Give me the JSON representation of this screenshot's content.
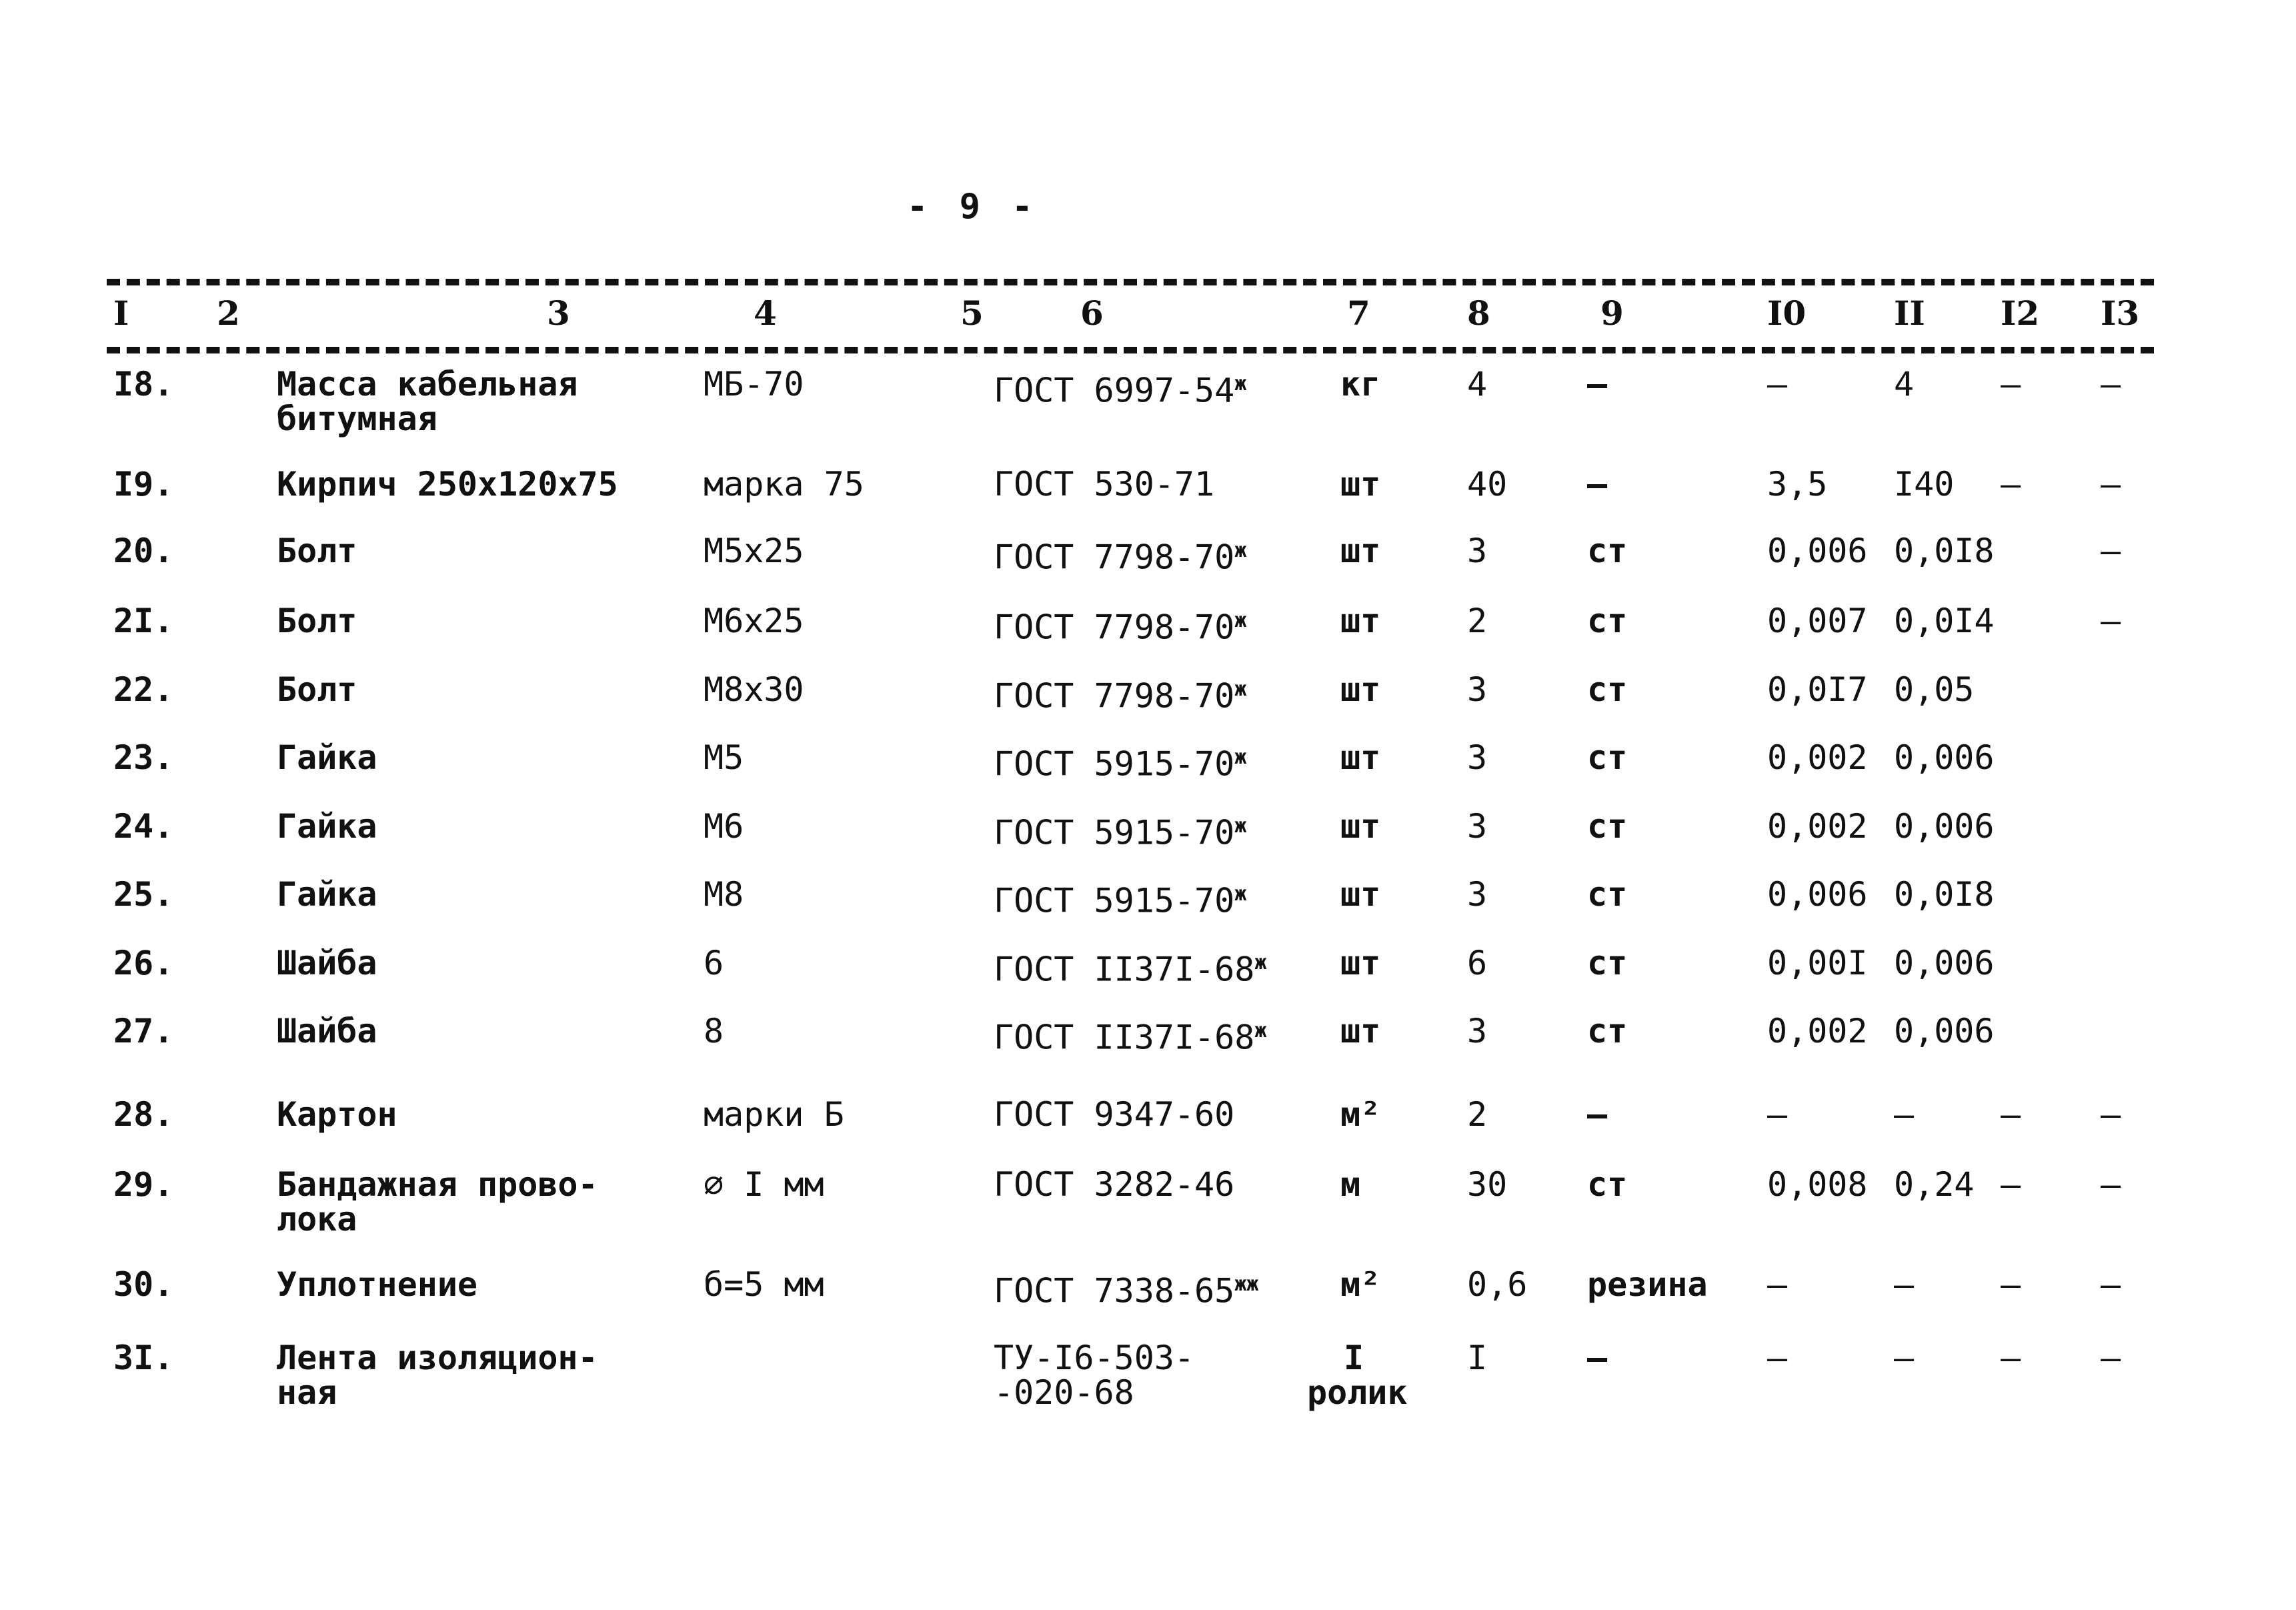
{
  "page": {
    "page_number": "- 9 -"
  },
  "table": {
    "column_headers": [
      "I",
      "2",
      "3",
      "4",
      "5",
      "6",
      "7",
      "8",
      "9",
      "I0",
      "II",
      "I2",
      "I3"
    ],
    "rows": [
      {
        "num": "I8.",
        "name": "Масса кабельная\nбитумная",
        "grade": "МБ-70",
        "standard": "ГОСТ 6997-54",
        "standard_mark": "ж",
        "unit": "кг",
        "qty": "4",
        "material": "–",
        "c10": "–",
        "c11": "4",
        "c12": "–",
        "c13": "–"
      },
      {
        "num": "I9.",
        "name": "Кирпич 250х120х75",
        "grade": "марка 75",
        "standard": "ГОСТ 530-71",
        "standard_mark": "",
        "unit": "шт",
        "qty": "40",
        "material": "–",
        "c10": "3,5",
        "c11": "I40",
        "c12": "–",
        "c13": "–"
      },
      {
        "num": "20.",
        "name": "Болт",
        "grade": "М5х25",
        "standard": "ГОСТ 7798-70",
        "standard_mark": "ж",
        "unit": "шт",
        "qty": "3",
        "material": "ст",
        "c10": "0,006",
        "c11": "0,0I8",
        "c12": "",
        "c13": "–"
      },
      {
        "num": "2I.",
        "name": "Болт",
        "grade": "М6х25",
        "standard": "ГОСТ 7798-70",
        "standard_mark": "ж",
        "unit": "шт",
        "qty": "2",
        "material": "ст",
        "c10": "0,007",
        "c11": "0,0I4",
        "c12": "",
        "c13": "–"
      },
      {
        "num": "22.",
        "name": "Болт",
        "grade": "М8х30",
        "standard": "ГОСТ 7798-70",
        "standard_mark": "ж",
        "unit": "шт",
        "qty": "3",
        "material": "ст",
        "c10": "0,0I7",
        "c11": "0,05",
        "c12": "",
        "c13": ""
      },
      {
        "num": "23.",
        "name": "Гайка",
        "grade": "М5",
        "standard": "ГОСТ 5915-70",
        "standard_mark": "ж",
        "unit": "шт",
        "qty": "3",
        "material": "ст",
        "c10": "0,002",
        "c11": "0,006",
        "c12": "",
        "c13": ""
      },
      {
        "num": "24.",
        "name": "Гайка",
        "grade": "М6",
        "standard": "ГОСТ 5915-70",
        "standard_mark": "ж",
        "unit": "шт",
        "qty": "3",
        "material": "ст",
        "c10": "0,002",
        "c11": "0,006",
        "c12": "",
        "c13": ""
      },
      {
        "num": "25.",
        "name": "Гайка",
        "grade": "М8",
        "standard": "ГОСТ 5915-70",
        "standard_mark": "ж",
        "unit": "шт",
        "qty": "3",
        "material": "ст",
        "c10": "0,006",
        "c11": "0,0I8",
        "c12": "",
        "c13": ""
      },
      {
        "num": "26.",
        "name": "Шайба",
        "grade": "6",
        "standard": "ГОСТ II37I-68",
        "standard_mark": "ж",
        "unit": "шт",
        "qty": "6",
        "material": "ст",
        "c10": "0,00I",
        "c11": "0,006",
        "c12": "",
        "c13": ""
      },
      {
        "num": "27.",
        "name": "Шайба",
        "grade": "8",
        "standard": "ГОСТ II37I-68",
        "standard_mark": "ж",
        "unit": "шт",
        "qty": "3",
        "material": "ст",
        "c10": "0,002",
        "c11": "0,006",
        "c12": "",
        "c13": ""
      },
      {
        "num": "28.",
        "name": "Картон",
        "grade": "марки Б",
        "standard": "ГОСТ 9347-60",
        "standard_mark": "",
        "unit": "м²",
        "qty": "2",
        "material": "–",
        "c10": "–",
        "c11": "–",
        "c12": "–",
        "c13": "–"
      },
      {
        "num": "29.",
        "name": "Бандажная прово-\nлока",
        "grade": "∅ I мм",
        "standard": "ГОСТ 3282-46",
        "standard_mark": "",
        "unit": "м",
        "qty": "30",
        "material": "ст",
        "c10": "0,008",
        "c11": "0,24",
        "c12": "–",
        "c13": "–"
      },
      {
        "num": "30.",
        "name": "Уплотнение",
        "grade": "б=5 мм",
        "standard": "ГОСТ 7338-65",
        "standard_mark": "жж",
        "unit": "м²",
        "qty": "0,6",
        "material": "резина",
        "c10": "–",
        "c11": "–",
        "c12": "–",
        "c13": "–"
      },
      {
        "num": "3I.",
        "name": "Лента изоляцион-\nная",
        "grade": "",
        "standard": "ТУ-I6-503-\n-020-68",
        "standard_mark": "",
        "unit": "I\nролик",
        "qty": "I",
        "material": "–",
        "c10": "–",
        "c11": "–",
        "c12": "–",
        "c13": "–"
      }
    ]
  }
}
